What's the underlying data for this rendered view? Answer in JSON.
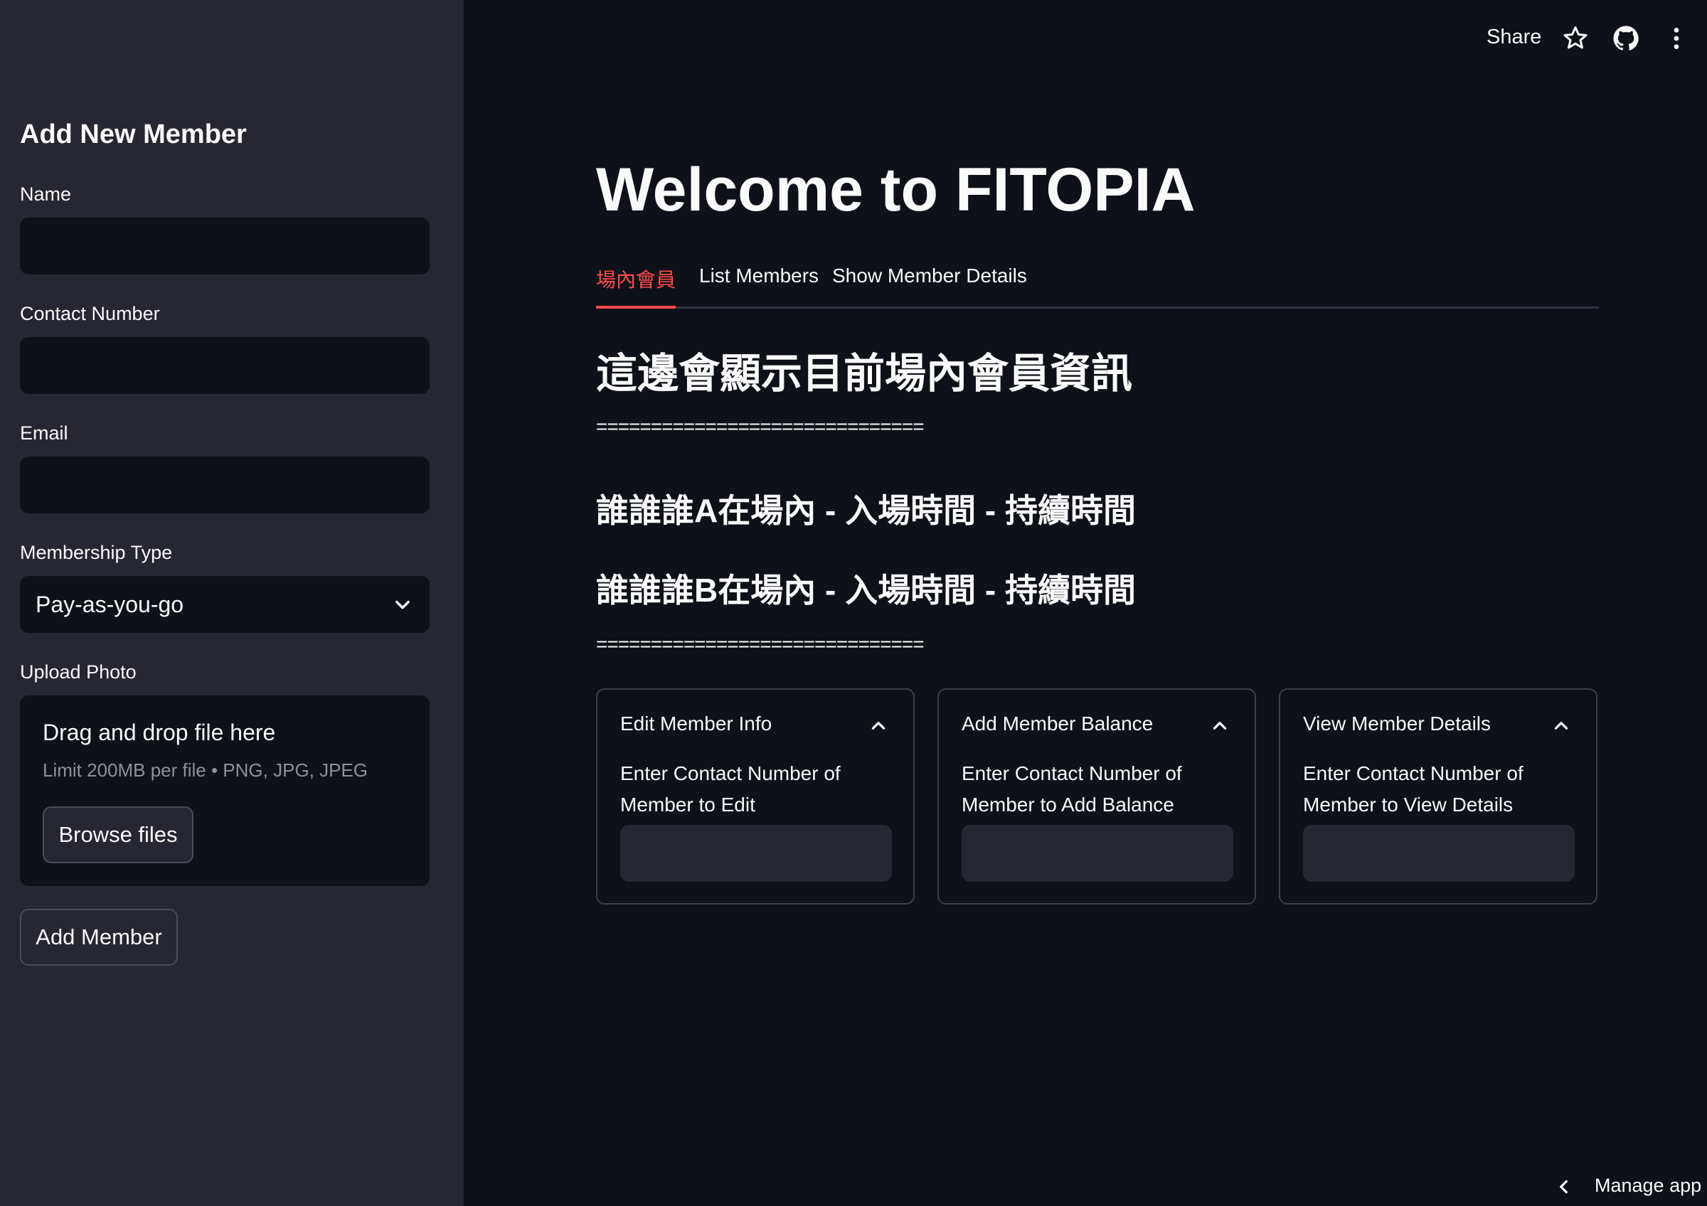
{
  "header": {
    "share_label": "Share",
    "icons": [
      "star-icon",
      "github-icon",
      "more-vertical-icon"
    ]
  },
  "sidebar": {
    "title": "Add New Member",
    "name_label": "Name",
    "contact_label": "Contact Number",
    "email_label": "Email",
    "membership_label": "Membership Type",
    "membership_value": "Pay-as-you-go",
    "upload_label": "Upload Photo",
    "upload_drag_text": "Drag and drop file here",
    "upload_limit_text": "Limit 200MB per file • PNG, JPG, JPEG",
    "browse_button": "Browse files",
    "add_button": "Add Member"
  },
  "main": {
    "title": "Welcome to FITOPIA",
    "tabs": [
      {
        "label": "場內會員",
        "active": true
      },
      {
        "label": "List Members",
        "active": false
      },
      {
        "label": "Show Member Details",
        "active": false
      }
    ],
    "heading": "這邊會顯示目前場內會員資訊",
    "separator": "==============================",
    "rows": [
      "誰誰誰A在場內 - 入場時間 - 持續時間",
      "誰誰誰B在場內 - 入場時間 - 持續時間"
    ],
    "expanders": [
      {
        "title": "Edit Member Info",
        "label": "Enter Contact Number of Member to Edit"
      },
      {
        "title": "Add Member Balance",
        "label": "Enter Contact Number of Member to Add Balance"
      },
      {
        "title": "View Member Details",
        "label": "Enter Contact Number of Member to View Details"
      }
    ]
  },
  "footer": {
    "manage_label": "Manage app"
  },
  "colors": {
    "background": "#0e1117",
    "sidebar": "#262730",
    "accent": "#ff4b4b",
    "text": "#fafafa"
  }
}
